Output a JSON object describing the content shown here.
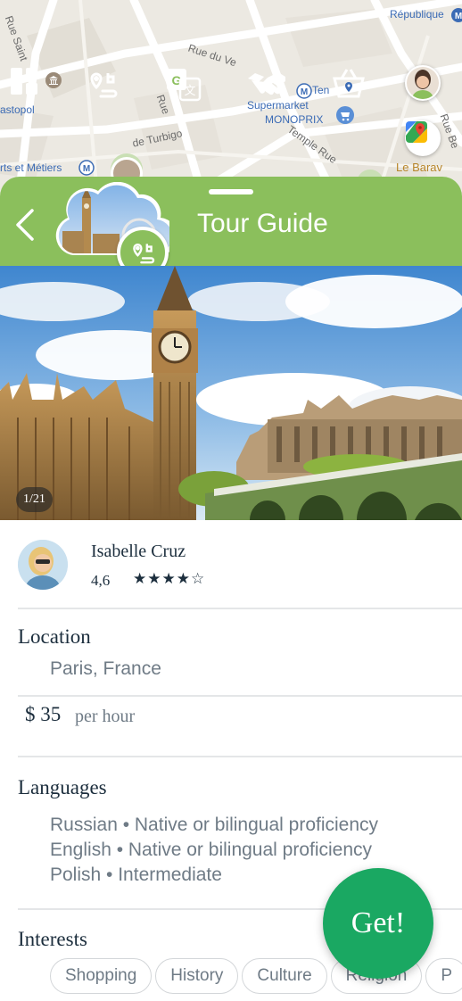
{
  "map": {
    "labels": {
      "republique": "République",
      "rue_saint": "Rue Saint",
      "astopol": "astopol",
      "rue_du_ve": "Rue du Ve",
      "rue_small": "Rue",
      "de_turbigo": "de Turbigo",
      "supermarket": "Supermarket",
      "monoprix": "MONOPRIX",
      "temple_rue": "Temple Rue",
      "ten": "Ten",
      "arts_metiers": "rts et Métiers",
      "le_barav": "Le Barav",
      "rue_be": "Rue Be"
    },
    "toolbar_icons": [
      "grid-icon",
      "route-pin-icon",
      "translate-icon",
      "handshake-icon",
      "basket-pin-icon"
    ],
    "right_icons": [
      "user-avatar",
      "google-maps-icon"
    ]
  },
  "header": {
    "title": "Tour Guide",
    "back_icon": "chevron-left-icon",
    "accent": "#8bbf5c"
  },
  "gallery": {
    "counter": "1/21"
  },
  "guide": {
    "name": "Isabelle Cruz",
    "rating": "4,6",
    "stars": "★★★★☆"
  },
  "location": {
    "title": "Location",
    "value": "Paris, France"
  },
  "price": {
    "amount": "$ 35",
    "unit": "per hour"
  },
  "languages": {
    "title": "Languages",
    "items": [
      "Russian • Native or bilingual proficiency",
      "English • Native or bilingual proficiency",
      "Polish • Intermediate"
    ]
  },
  "interests": {
    "title": "Interests",
    "chips": [
      "Shopping",
      "History",
      "Culture",
      "Religion",
      "P"
    ]
  },
  "cta": {
    "label": "Get!",
    "color": "#1aa862"
  }
}
